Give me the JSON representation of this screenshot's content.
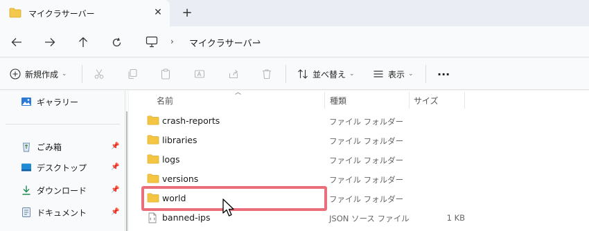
{
  "tab": {
    "title": "マイクラサーバー",
    "close": "✕",
    "new_tab": "+"
  },
  "nav": {
    "back": "←",
    "forward": "→",
    "up": "↑",
    "refresh": "↻"
  },
  "address": {
    "separator": "›",
    "crumbs": [
      "マイクラサーバー"
    ]
  },
  "toolbar": {
    "new_label": "新規作成",
    "sort_label": "並べ替え",
    "view_label": "表示",
    "more_label": "···"
  },
  "sidebar": {
    "items": [
      {
        "label": "ギャラリー",
        "icon": "gallery-icon"
      },
      {
        "label": "ごみ箱",
        "icon": "recycle-bin-icon",
        "pinned": true
      },
      {
        "label": "デスクトップ",
        "icon": "desktop-icon",
        "pinned": true
      },
      {
        "label": "ダウンロード",
        "icon": "download-icon",
        "pinned": true
      },
      {
        "label": "ドキュメント",
        "icon": "documents-icon",
        "pinned": true
      }
    ]
  },
  "columns": {
    "name": "名前",
    "type": "種類",
    "size": "サイズ"
  },
  "files": [
    {
      "name": "crash-reports",
      "type": "ファイル フォルダー",
      "size": "",
      "icon": "folder-icon"
    },
    {
      "name": "libraries",
      "type": "ファイル フォルダー",
      "size": "",
      "icon": "folder-icon"
    },
    {
      "name": "logs",
      "type": "ファイル フォルダー",
      "size": "",
      "icon": "folder-icon"
    },
    {
      "name": "versions",
      "type": "ファイル フォルダー",
      "size": "",
      "icon": "folder-icon"
    },
    {
      "name": "world",
      "type": "ファイル フォルダー",
      "size": "",
      "icon": "folder-icon",
      "highlighted": true
    },
    {
      "name": "banned-ips",
      "type": "JSON ソース ファイル",
      "size": "1 KB",
      "icon": "json-file-icon"
    }
  ],
  "colors": {
    "highlight": "#ea6f7a",
    "folder": "#f2c94c",
    "accent": "#0067c0"
  }
}
